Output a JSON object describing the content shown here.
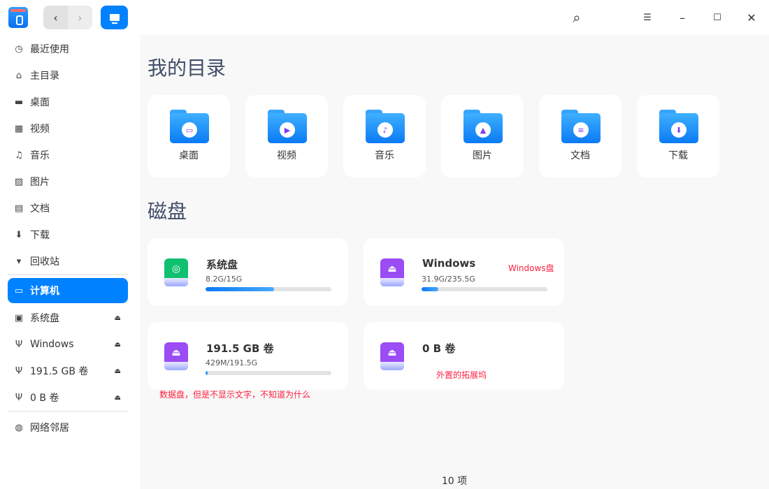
{
  "titlebar": {
    "nav_back": "‹",
    "nav_forward": "›",
    "search_icon": "⌕",
    "menu_icon": "☰",
    "minimize_icon": "–",
    "maximize_icon": "☐",
    "close_icon": "✕"
  },
  "sidebar": {
    "items": [
      {
        "label": "最近使用",
        "icon": "clock-icon",
        "glyph": "◷"
      },
      {
        "label": "主目录",
        "icon": "home-icon",
        "glyph": "⌂"
      },
      {
        "label": "桌面",
        "icon": "desktop-icon",
        "glyph": "▬"
      },
      {
        "label": "视频",
        "icon": "video-icon",
        "glyph": "▦"
      },
      {
        "label": "音乐",
        "icon": "music-icon",
        "glyph": "♫"
      },
      {
        "label": "图片",
        "icon": "picture-icon",
        "glyph": "▨"
      },
      {
        "label": "文档",
        "icon": "document-icon",
        "glyph": "▤"
      },
      {
        "label": "下载",
        "icon": "download-icon",
        "glyph": "⬇"
      },
      {
        "label": "回收站",
        "icon": "trash-icon",
        "glyph": "▾"
      },
      {
        "label": "计算机",
        "icon": "computer-icon",
        "glyph": "▭"
      },
      {
        "label": "系统盘",
        "icon": "disk-icon",
        "glyph": "▣"
      },
      {
        "label": "Windows",
        "icon": "usb-icon",
        "glyph": "Ψ"
      },
      {
        "label": "191.5 GB 卷",
        "icon": "usb-icon",
        "glyph": "Ψ"
      },
      {
        "label": "0 B 卷",
        "icon": "usb-icon",
        "glyph": "Ψ"
      },
      {
        "label": "网络邻居",
        "icon": "network-icon",
        "glyph": "◍"
      }
    ],
    "eject_glyph": "⏏"
  },
  "main": {
    "dirs_title": "我的目录",
    "folders": [
      {
        "label": "桌面",
        "emblem": "▭"
      },
      {
        "label": "视频",
        "emblem": "▶"
      },
      {
        "label": "音乐",
        "emblem": "♪"
      },
      {
        "label": "图片",
        "emblem": "▲"
      },
      {
        "label": "文档",
        "emblem": "≡"
      },
      {
        "label": "下载",
        "emblem": "⬇"
      }
    ],
    "disks_title": "磁盘",
    "disks": [
      {
        "name": "系统盘",
        "size": "8.2G/15G",
        "usage": 0.547,
        "color": "#10c070",
        "glyph": "◎"
      },
      {
        "name": "Windows",
        "size": "31.9G/235.5G",
        "usage": 0.135,
        "color": "#9a4cf5",
        "glyph": "⏏"
      },
      {
        "name": "191.5 GB 卷",
        "size": "429M/191.5G",
        "usage": 0.002,
        "color": "#9a4cf5",
        "glyph": "⏏"
      },
      {
        "name": "0 B 卷",
        "color": "#9a4cf5",
        "glyph": "⏏"
      }
    ],
    "notes": {
      "windows": "Windows盘",
      "data": "数据盘，但是不显示文字，不知道为什么",
      "external": "外置的拓展坞"
    },
    "item_count": "10 项"
  }
}
